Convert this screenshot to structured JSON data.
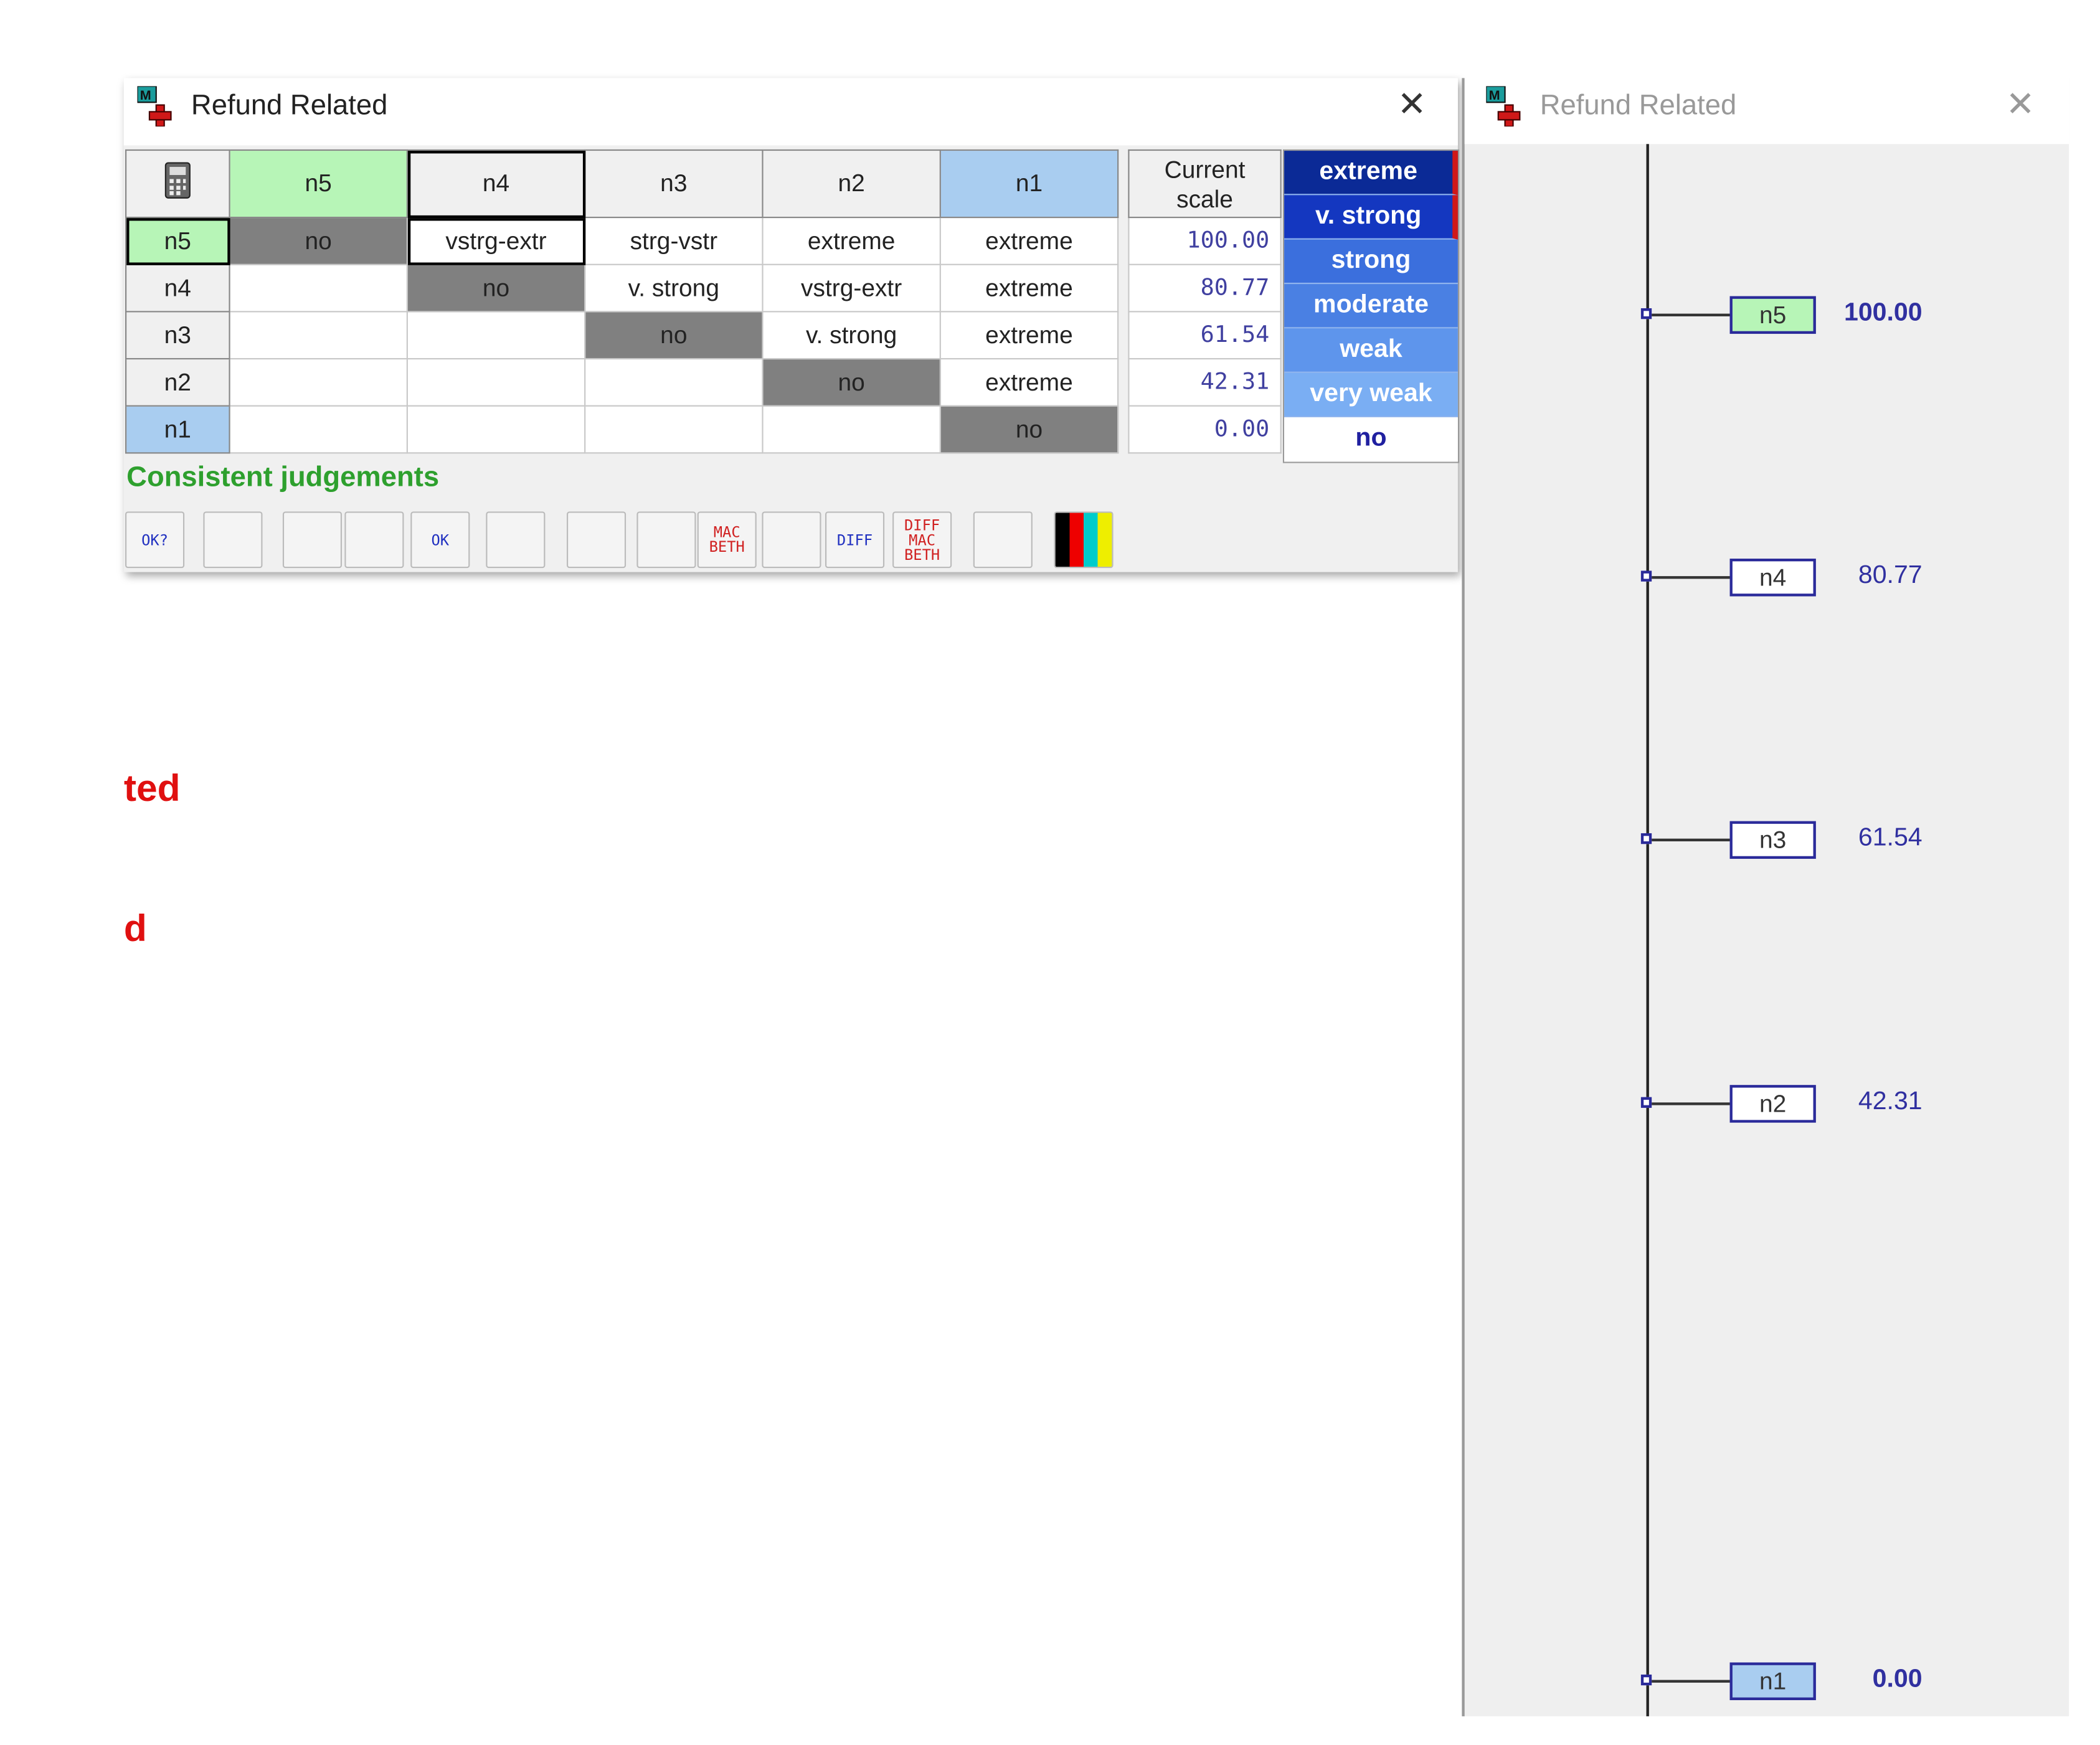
{
  "left_window": {
    "title": "Refund Related",
    "close_glyph": "✕",
    "corner_icon": "calculator-icon",
    "columns": [
      "n5",
      "n4",
      "n3",
      "n2",
      "n1"
    ],
    "rows": [
      {
        "label": "n5",
        "cells": [
          "no",
          "vstrg-extr",
          "strg-vstr",
          "extreme",
          "extreme"
        ]
      },
      {
        "label": "n4",
        "cells": [
          "",
          "no",
          "v. strong",
          "vstrg-extr",
          "extreme"
        ]
      },
      {
        "label": "n3",
        "cells": [
          "",
          "",
          "no",
          "v. strong",
          "extreme"
        ]
      },
      {
        "label": "n2",
        "cells": [
          "",
          "",
          "",
          "no",
          "extreme"
        ]
      },
      {
        "label": "n1",
        "cells": [
          "",
          "",
          "",
          "",
          "no"
        ]
      }
    ],
    "current_scale": {
      "header_line1": "Current",
      "header_line2": "scale",
      "values": [
        "100.00",
        "80.77",
        "61.54",
        "42.31",
        "0.00"
      ]
    },
    "judgement_palette": [
      {
        "label": "extreme",
        "color": "#0b2a96"
      },
      {
        "label": "v. strong",
        "color": "#1437c0"
      },
      {
        "label": "strong",
        "color": "#3b6fdd"
      },
      {
        "label": "moderate",
        "color": "#4a80e3"
      },
      {
        "label": "weak",
        "color": "#5e95ec"
      },
      {
        "label": "very weak",
        "color": "#7aaef3"
      },
      {
        "label": "no",
        "color": "#ffffff"
      }
    ],
    "status": "Consistent judgements",
    "status_color": "#2ea02e",
    "toolbar": [
      {
        "name": "consistency-check-icon",
        "text": "OK?"
      },
      {
        "name": "refresh-icon",
        "text": ""
      },
      {
        "name": "suggestion-bulb-icon",
        "text": ""
      },
      {
        "name": "bulb-icon",
        "text": ""
      },
      {
        "name": "bulb-ok-icon",
        "text": "OK"
      },
      {
        "name": "add-nodes-icon",
        "text": ""
      },
      {
        "name": "matrix-to-scale-icon",
        "text": ""
      },
      {
        "name": "scale-list-icon",
        "text": ""
      },
      {
        "name": "macbeth-matrix-icon",
        "text": "MAC BETH"
      },
      {
        "name": "interval-icon",
        "text": ""
      },
      {
        "name": "diff-icon",
        "text": "DIFF"
      },
      {
        "name": "diff-macbeth-icon",
        "text": "DIFF MAC BETH"
      },
      {
        "name": "figure-scale-icon",
        "text": ""
      },
      {
        "name": "color-palette-icon",
        "text": ""
      }
    ]
  },
  "background_text": [
    "ted",
    "d"
  ],
  "right_window": {
    "title": "Refund Related",
    "close_glyph": "✕",
    "scale_nodes": [
      {
        "label": "n5",
        "value": "100.00",
        "numeric": 100.0,
        "fill": "#b7f5b7"
      },
      {
        "label": "n4",
        "value": "80.77",
        "numeric": 80.77,
        "fill": "#ffffff"
      },
      {
        "label": "n3",
        "value": "61.54",
        "numeric": 61.54,
        "fill": "#ffffff"
      },
      {
        "label": "n2",
        "value": "42.31",
        "numeric": 42.31,
        "fill": "#ffffff"
      },
      {
        "label": "n1",
        "value": "0.00",
        "numeric": 0.0,
        "fill": "#a9cdf0"
      }
    ]
  }
}
